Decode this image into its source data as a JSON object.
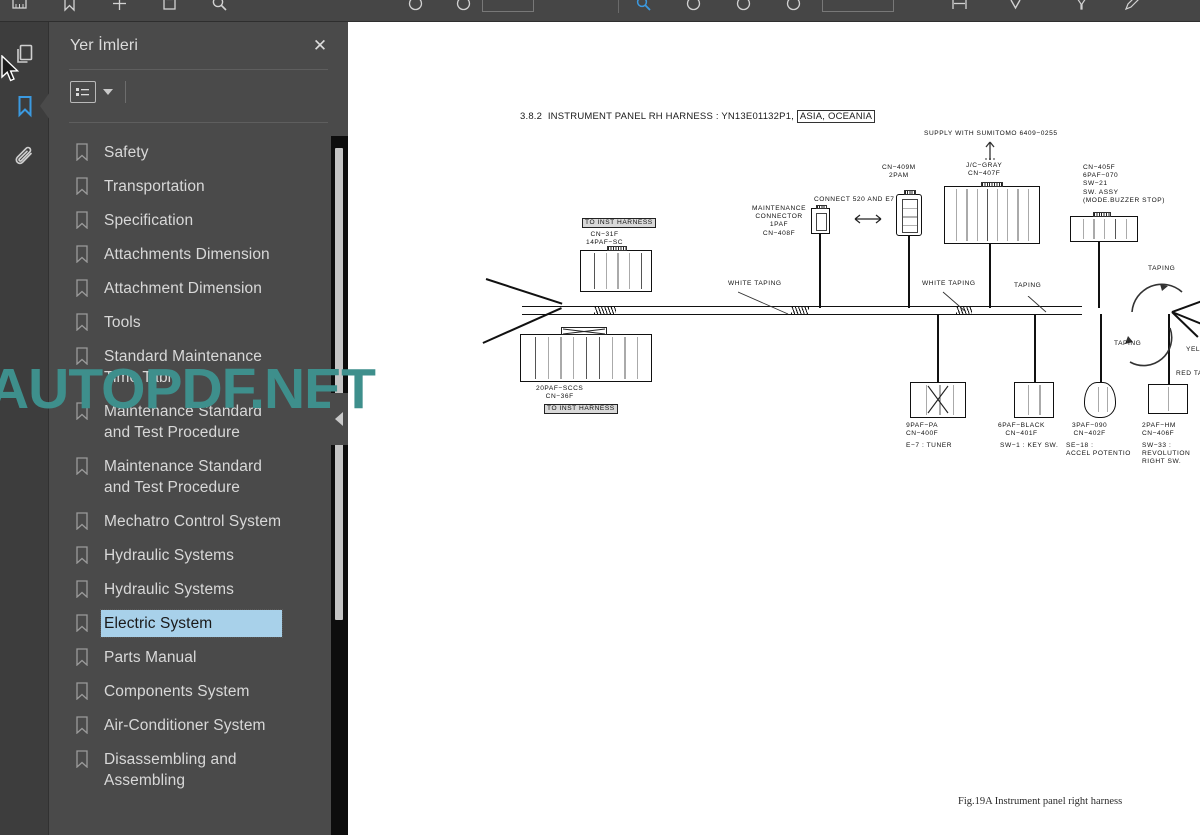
{
  "app": {
    "name": "pdf-reader",
    "accent_color": "#3b9ae1",
    "panel_bg": "#4a4a4a",
    "selection_color": "#a8d1ea",
    "watermark_color": "#3e8f8c"
  },
  "toolbar": {
    "left_items": [
      {
        "name": "page-view-icon",
        "label": "Page View"
      },
      {
        "name": "bookmark-add-icon",
        "label": "Add Bookmark"
      },
      {
        "name": "crosshair-icon",
        "label": "Select"
      },
      {
        "name": "snapshot-icon",
        "label": "Snapshot"
      },
      {
        "name": "search-icon",
        "label": "Find"
      }
    ],
    "center_items": [
      {
        "name": "previous-page-icon",
        "label": "Previous Page"
      },
      {
        "name": "next-page-icon",
        "label": "Next Page"
      }
    ],
    "page_field_value": "",
    "right_items": [
      {
        "name": "zoom-tool-icon",
        "label": "Zoom Tool"
      },
      {
        "name": "zoom-out-icon",
        "label": "Zoom Out"
      },
      {
        "name": "zoom-reset-icon",
        "label": "Zoom Reset"
      },
      {
        "name": "zoom-in-icon",
        "label": "Zoom In"
      },
      {
        "name": "fit-width-icon",
        "label": "Fit Width"
      },
      {
        "name": "rotate-icon",
        "label": "Rotate"
      },
      {
        "name": "highlight-icon",
        "label": "Highlight"
      },
      {
        "name": "pen-icon",
        "label": "Draw"
      }
    ],
    "zoom_field_value": ""
  },
  "rail": {
    "items": [
      {
        "name": "pages-icon",
        "label": "Pages",
        "active": false
      },
      {
        "name": "bookmark-icon",
        "label": "Bookmarks",
        "active": true
      },
      {
        "name": "attachments-icon",
        "label": "Attachments",
        "active": false
      }
    ]
  },
  "panel": {
    "title": "Yer İmleri",
    "close_label": "✕",
    "options_icon": "list-options-icon",
    "items": [
      {
        "label": "Safety",
        "selected": false
      },
      {
        "label": "Transportation",
        "selected": false
      },
      {
        "label": "Specification",
        "selected": false
      },
      {
        "label": "Attachments Dimension",
        "selected": false
      },
      {
        "label": "Attachment Dimension",
        "selected": false
      },
      {
        "label": "Tools",
        "selected": false
      },
      {
        "label": "Standard Maintenance Time Table",
        "selected": false
      },
      {
        "label": "Maintenance Standard and Test Procedure",
        "selected": false
      },
      {
        "label": "Maintenance Standard and Test Procedure",
        "selected": false
      },
      {
        "label": "Mechatro Control System",
        "selected": false
      },
      {
        "label": "Hydraulic Systems",
        "selected": false
      },
      {
        "label": "Hydraulic Systems",
        "selected": false
      },
      {
        "label": "Electric System",
        "selected": true
      },
      {
        "label": "Parts Manual",
        "selected": false
      },
      {
        "label": "Components System",
        "selected": false
      },
      {
        "label": "Air-Conditioner System",
        "selected": false
      },
      {
        "label": "Disassembling and Assembling",
        "selected": false
      }
    ]
  },
  "document": {
    "title_number": "3.8.2",
    "title_text": "INSTRUMENT PANEL RH HARNESS : YN13E01132P1,",
    "title_region": "ASIA, OCEANIA",
    "figure_caption": "Fig.19A  Instrument panel right harness",
    "watermark": "AUTOPDF.NET",
    "labels": [
      {
        "id": "to-inst-harness-top",
        "text": "TO INST HARNESS"
      },
      {
        "id": "cn-31f",
        "text": "CN−31F\n14PAF−SC"
      },
      {
        "id": "cn-36f",
        "text": "20PAF−SCCS\nCN−36F"
      },
      {
        "id": "to-inst-harness-bottom",
        "text": "TO INST HARNESS"
      },
      {
        "id": "maintenance-connector",
        "text": "MAINTENANCE\nCONNECTOR\n1PAF\nCN−408F"
      },
      {
        "id": "connect-520-e7",
        "text": "CONNECT 520 AND E7"
      },
      {
        "id": "cn-409m",
        "text": "CN−409M\n2PAM"
      },
      {
        "id": "supply-sumitomo",
        "text": "SUPPLY WITH SUMITOMO 6409−0255"
      },
      {
        "id": "jc-gray",
        "text": "J/C−GRAY\nCN−407F"
      },
      {
        "id": "cn-405f",
        "text": "CN−405F\n6PAF−070\nSW−21\nSW. ASSY\n(MODE.BUZZER STOP)"
      },
      {
        "id": "white-taping-1",
        "text": "WHITE TAPING"
      },
      {
        "id": "white-taping-2",
        "text": "WHITE TAPING"
      },
      {
        "id": "taping-1",
        "text": "TAPING"
      },
      {
        "id": "taping-2",
        "text": "TAPING"
      },
      {
        "id": "taping-3",
        "text": "TAPING"
      },
      {
        "id": "red-taping",
        "text": "RED TAPI"
      },
      {
        "id": "yellow-taping",
        "text": "YEL"
      },
      {
        "id": "cn-400f",
        "text": "9PAF−PA\nCN−400F"
      },
      {
        "id": "cn-400f-note",
        "text": "E−7 : TUNER"
      },
      {
        "id": "cn-401f",
        "text": "6PAF−BLACK\nCN−401F"
      },
      {
        "id": "cn-401f-note",
        "text": "SW−1 : KEY SW."
      },
      {
        "id": "cn-402f",
        "text": "3PAF−090\nCN−402F"
      },
      {
        "id": "cn-402f-note",
        "text": "SE−18 :\nACCEL POTENTIO"
      },
      {
        "id": "cn-406f",
        "text": "2PAF−HM\nCN−406F"
      },
      {
        "id": "cn-406f-note",
        "text": "SW−33 :\nREVOLUTION\nRIGHT SW."
      }
    ]
  }
}
